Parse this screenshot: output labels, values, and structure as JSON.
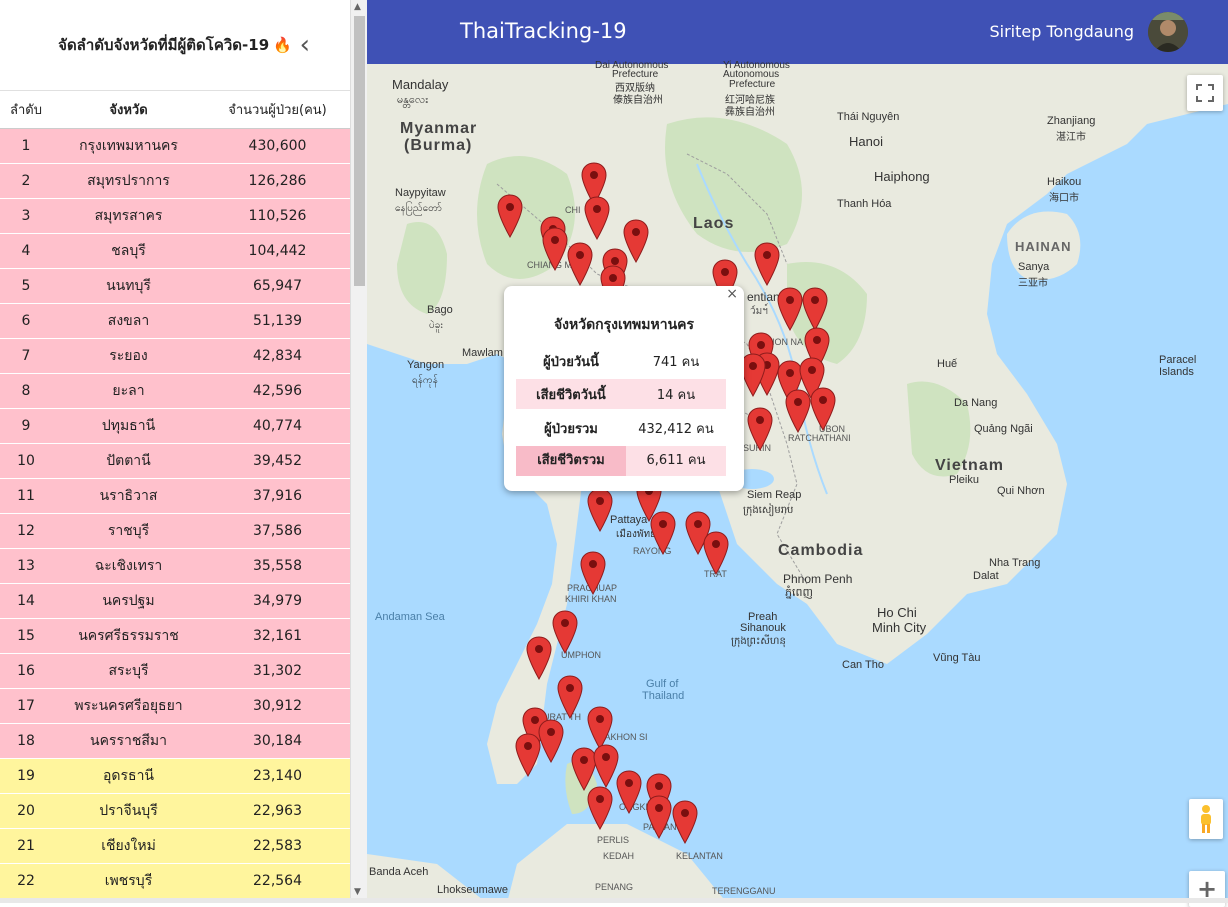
{
  "sidebar": {
    "title": "จัดลำดับจังหวัดที่มีผู้ติดโควิด-19",
    "flame_icon": "🔥",
    "collapse_icon": "‹",
    "columns": [
      "ลำดับ",
      "จังหวัด",
      "จำนวนผู้ป่วย(คน)"
    ],
    "rows": [
      {
        "rank": "1",
        "province": "กรุงเทพมหานคร",
        "cases": "430,600",
        "level": "red"
      },
      {
        "rank": "2",
        "province": "สมุทรปราการ",
        "cases": "126,286",
        "level": "red"
      },
      {
        "rank": "3",
        "province": "สมุทรสาคร",
        "cases": "110,526",
        "level": "red"
      },
      {
        "rank": "4",
        "province": "ชลบุรี",
        "cases": "104,442",
        "level": "red"
      },
      {
        "rank": "5",
        "province": "นนทบุรี",
        "cases": "65,947",
        "level": "red"
      },
      {
        "rank": "6",
        "province": "สงขลา",
        "cases": "51,139",
        "level": "red"
      },
      {
        "rank": "7",
        "province": "ระยอง",
        "cases": "42,834",
        "level": "red"
      },
      {
        "rank": "8",
        "province": "ยะลา",
        "cases": "42,596",
        "level": "red"
      },
      {
        "rank": "9",
        "province": "ปทุมธานี",
        "cases": "40,774",
        "level": "red"
      },
      {
        "rank": "10",
        "province": "ปัตตานี",
        "cases": "39,452",
        "level": "red"
      },
      {
        "rank": "11",
        "province": "นราธิวาส",
        "cases": "37,916",
        "level": "red"
      },
      {
        "rank": "12",
        "province": "ราชบุรี",
        "cases": "37,586",
        "level": "red"
      },
      {
        "rank": "13",
        "province": "ฉะเชิงเทรา",
        "cases": "35,558",
        "level": "red"
      },
      {
        "rank": "14",
        "province": "นครปฐม",
        "cases": "34,979",
        "level": "red"
      },
      {
        "rank": "15",
        "province": "นครศรีธรรมราช",
        "cases": "32,161",
        "level": "red"
      },
      {
        "rank": "16",
        "province": "สระบุรี",
        "cases": "31,302",
        "level": "red"
      },
      {
        "rank": "17",
        "province": "พระนครศรีอยุธยา",
        "cases": "30,912",
        "level": "red"
      },
      {
        "rank": "18",
        "province": "นครราชสีมา",
        "cases": "30,184",
        "level": "red"
      },
      {
        "rank": "19",
        "province": "อุดรธานี",
        "cases": "23,140",
        "level": "yellow"
      },
      {
        "rank": "20",
        "province": "ปราจีนบุรี",
        "cases": "22,963",
        "level": "yellow"
      },
      {
        "rank": "21",
        "province": "เชียงใหม่",
        "cases": "22,583",
        "level": "yellow"
      },
      {
        "rank": "22",
        "province": "เพชรบุรี",
        "cases": "22,564",
        "level": "yellow"
      }
    ]
  },
  "topbar": {
    "app_title": "ThaiTracking-19",
    "user_name": "Siritep Tongdaung"
  },
  "popup": {
    "title": "จังหวัดกรุงเทพมหานคร",
    "close_icon": "×",
    "rows": [
      {
        "label": "ผู้ป่วยวันนี้",
        "value": "741 คน"
      },
      {
        "label": "เสียชีวิตวันนี้",
        "value": "14 คน"
      },
      {
        "label": "ผู้ป่วยรวม",
        "value": "432,412 คน"
      },
      {
        "label": "เสียชีวิตรวม",
        "value": "6,611 คน"
      }
    ]
  },
  "map": {
    "labels": {
      "mandalay": "Mandalay",
      "mandalay_local": "မန္တလေး",
      "myanmar": "Myanmar",
      "burma": "(Burma)",
      "naypyitaw": "Naypyitaw",
      "naypyitaw_local": "နေပြည်တော်",
      "bago": "Bago",
      "bago_local": "ပဲခူး",
      "yangon": "Yangon",
      "yangon_local": "ရန်ကုန်",
      "mawlam": "Mawlam",
      "laos": "Laos",
      "vientiane": "entiane",
      "hanoi": "Hanoi",
      "haiphong": "Haiphong",
      "thai_nguyen": "Thái Nguyên",
      "thanh_hoa": "Thanh Hóa",
      "zhanjiang": "Zhanjiang",
      "zhanjiang_local": "湛江市",
      "haikou": "Haikou",
      "haikou_local": "海口市",
      "hainan": "HAINAN",
      "sanya": "Sanya",
      "sanya_local": "三亚市",
      "vietnam": "Vietnam",
      "hue": "Huế",
      "da_nang": "Da Nang",
      "quang_ngai": "Quảng Ngãi",
      "paracel": "Paracel",
      "islands": "Islands",
      "pleiku": "Pleiku",
      "qui_nhon": "Qui Nhơn",
      "cambodia": "Cambodia",
      "siem_reap": "Siem Reap",
      "siem_reap_local": "ក្រុងសៀមរាប",
      "phnom_penh": "Phnom Penh",
      "phnom_penh_local": "ភ្នំពេញ",
      "preah_sihanouk": "Preah",
      "sihanouk": "Sihanouk",
      "sihanouk_local": "ក្រុងព្រះសីហនុ",
      "ho_chi_minh_1": "Ho Chi",
      "ho_chi_minh_2": "Minh City",
      "can_tho": "Can Tho",
      "vung_tau": "Vũng Tàu",
      "nha_trang": "Nha Trang",
      "dalat": "Dalat",
      "kratie": "Kr",
      "andaman_sea": "Andaman Sea",
      "gulf_1": "Gulf of",
      "gulf_2": "Thailand",
      "pattaya": "Pattaya",
      "pattaya_local": "เมืองพัทยา",
      "rayong": "RAYONG",
      "trat": "TRAT",
      "prachuap_1": "PRACHUAP",
      "prachuap_2": "KHIRI KHAN",
      "chumphon": "UMPHON",
      "surat": "URAT TH",
      "nakhon_si": "NAKHON SI",
      "songkhla": "ONGKHL",
      "pattani": "PATTAN",
      "perlis": "PERLIS",
      "kedah": "KEDAH",
      "kelantan": "KELANTAN",
      "penang": "PENANG",
      "banda_aceh": "Banda Aceh",
      "lhokseumawe": "Lhokseumawe",
      "terengganu": "TERENGGANU",
      "chiang_rai": "CHI",
      "chiang_mai": "CHIANG M",
      "surin": "SURIN",
      "ubon_1": "UBON",
      "ubon_2": "RATCHATHANI",
      "xishuangbanna_1": "Dai Autonomous",
      "xishuangbanna_2": "Prefecture",
      "xishuangbanna_3": "西双版纳",
      "xishuangbanna_4": "傣族自治州",
      "honghe_1": "Yi Autonomous",
      "honghe_2": "Autonomous",
      "honghe_3": "Prefecture",
      "honghe_4": "红河哈尼族",
      "honghe_5": "彝族自治州",
      "nakhon_phanom": "KHON NA",
      "nakhon_phanom_2": "ว์มฯ์"
    }
  },
  "controls": {
    "fullscreen_icon": "fullscreen-icon",
    "pegman_icon": "pegman-icon",
    "zoom_in": "+"
  },
  "colors": {
    "topbar": "#3f51b5",
    "row_red": "#ffc1cc",
    "row_yellow": "#fff59d",
    "marker": "#e53935",
    "water": "#aadaff",
    "land": "#e8e8e0"
  }
}
